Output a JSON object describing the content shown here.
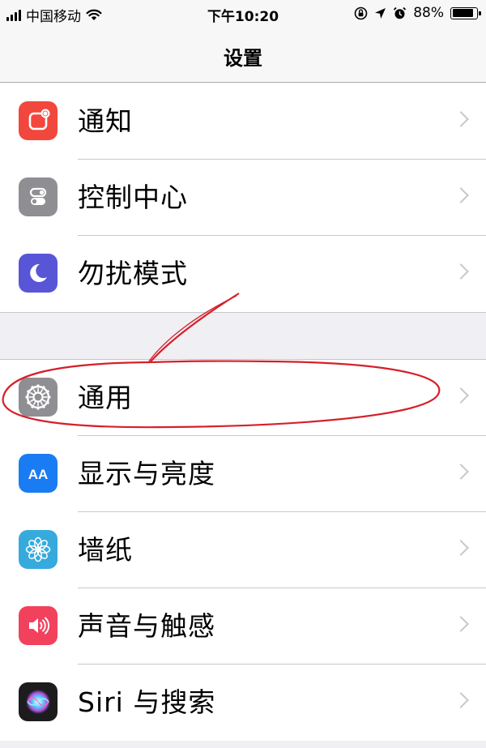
{
  "status_bar": {
    "carrier": "中国移动",
    "time": "下午10:20",
    "battery_percent": "88%",
    "battery_level": 0.88
  },
  "nav": {
    "title": "设置"
  },
  "groups": [
    {
      "items": [
        {
          "label": "通知",
          "icon": "notification-icon",
          "color": "#f2473d"
        },
        {
          "label": "控制中心",
          "icon": "control-center-icon",
          "color": "#8e8e93"
        },
        {
          "label": "勿扰模式",
          "icon": "moon-icon",
          "color": "#5856d6"
        }
      ]
    },
    {
      "items": [
        {
          "label": "通用",
          "icon": "gear-icon",
          "color": "#8e8e93"
        },
        {
          "label": "显示与亮度",
          "icon": "display-brightness-icon",
          "color": "#1a7cf2",
          "icon_text": "AA"
        },
        {
          "label": "墙纸",
          "icon": "wallpaper-flower-icon",
          "color": "#36aadc"
        },
        {
          "label": "声音与触感",
          "icon": "speaker-icon",
          "color": "#f2415d"
        },
        {
          "label": "Siri 与搜索",
          "icon": "siri-icon",
          "color": "#1c1c1e"
        }
      ]
    }
  ],
  "annotation_color": "#d6202a"
}
